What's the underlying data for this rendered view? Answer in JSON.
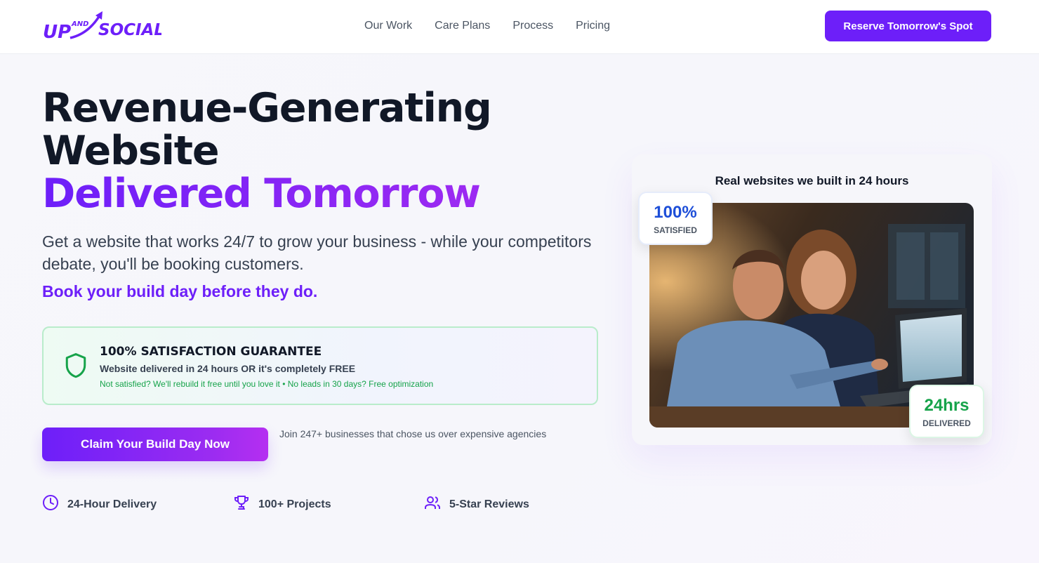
{
  "brand": {
    "logo_up": "UP",
    "logo_and": "AND",
    "logo_social": "SOCIAL"
  },
  "nav": {
    "links": [
      "Our Work",
      "Care Plans",
      "Process",
      "Pricing"
    ],
    "cta_label": "Reserve Tomorrow's Spot"
  },
  "hero": {
    "headline_line1": "Revenue-Generating",
    "headline_line2": "Website",
    "headline_line3": "Delivered Tomorrow",
    "subtitle": "Get a website that works 24/7 to grow your business - while your competitors debate, you'll be booking customers.",
    "booking_prompt": "Book your build day before they do.",
    "cta_label": "Claim Your Build Day Now",
    "social_proof": "Join 247+ businesses that chose us over expensive agencies"
  },
  "guarantee": {
    "title": "100% SATISFACTION GUARANTEE",
    "main": "Website delivered in 24 hours OR it's completely FREE",
    "note": "Not satisfied? We'll rebuild it free until you love it • No leads in 30 days? Free optimization",
    "icon": "shield-icon"
  },
  "features": [
    {
      "icon": "clock-icon",
      "label": "24-Hour Delivery"
    },
    {
      "icon": "trophy-icon",
      "label": "100+ Projects"
    },
    {
      "icon": "users-icon",
      "label": "5-Star Reviews"
    }
  ],
  "showcase": {
    "title": "Real websites we built in 24 hours",
    "badge_top_value": "100%",
    "badge_top_label": "SATISFIED",
    "badge_bottom_value": "24hrs",
    "badge_bottom_label": "DELIVERED"
  },
  "colors": {
    "accent": "#6d1ff9",
    "accent_end": "#b52ff1",
    "heading": "#111827",
    "success": "#16a34a",
    "info": "#1d4ed8"
  }
}
